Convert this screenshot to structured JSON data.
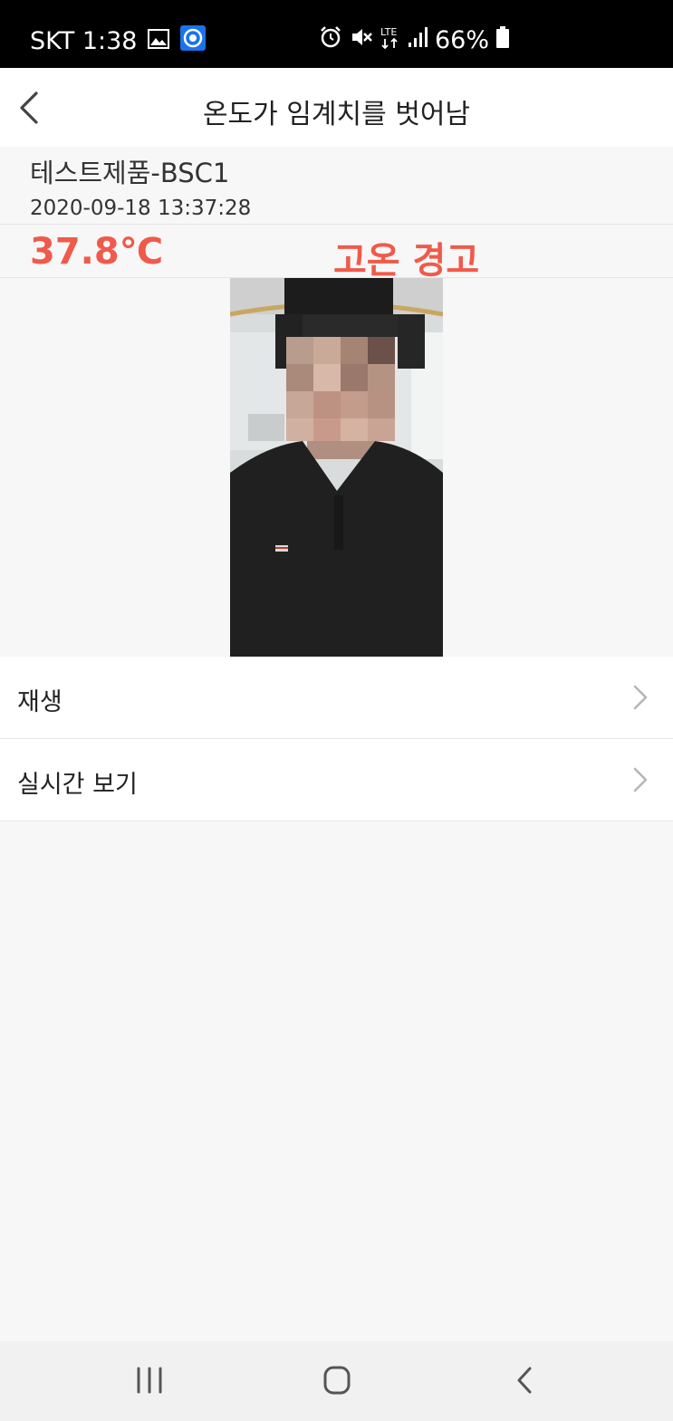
{
  "status_bar": {
    "carrier_time": "SKT 1:38",
    "battery": "66%",
    "icons": [
      "gallery-icon",
      "app-notification-icon",
      "alarm-icon",
      "mute-icon",
      "lte-icon",
      "signal-icon",
      "battery-icon"
    ]
  },
  "header": {
    "title": "온도가 임계치를 벗어남",
    "back_icon": "chevron-left-icon"
  },
  "event": {
    "device_name": "테스트제품-BSC1",
    "timestamp": "2020-09-18 13:37:28",
    "temperature": "37.8℃",
    "warning": "고온 경고",
    "alert_color": "#f05a4a"
  },
  "menu": {
    "items": [
      {
        "label": "재생"
      },
      {
        "label": "실시간 보기"
      }
    ]
  },
  "nav_bar": {
    "buttons": [
      "recents-icon",
      "home-icon",
      "back-icon"
    ]
  }
}
